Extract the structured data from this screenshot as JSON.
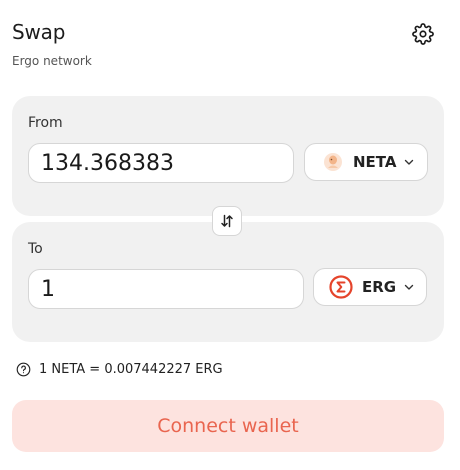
{
  "header": {
    "title": "Swap",
    "subtitle": "Ergo network",
    "settings_icon": "gear-icon"
  },
  "from": {
    "label": "From",
    "amount": "134.368383",
    "token": {
      "symbol": "NETA",
      "icon": "neta-token-icon"
    }
  },
  "to": {
    "label": "To",
    "amount": "1",
    "token": {
      "symbol": "ERG",
      "icon": "erg-token-icon"
    }
  },
  "switch_icon": "swap-arrows-icon",
  "rate": {
    "icon": "question-circle-icon",
    "text": "1 NETA = 0.007442227 ERG"
  },
  "connect_button": "Connect wallet",
  "colors": {
    "panel_bg": "#f1f1f1",
    "connect_bg": "#fde3df",
    "connect_text": "#e9654f",
    "erg_brand": "#e5442b"
  }
}
